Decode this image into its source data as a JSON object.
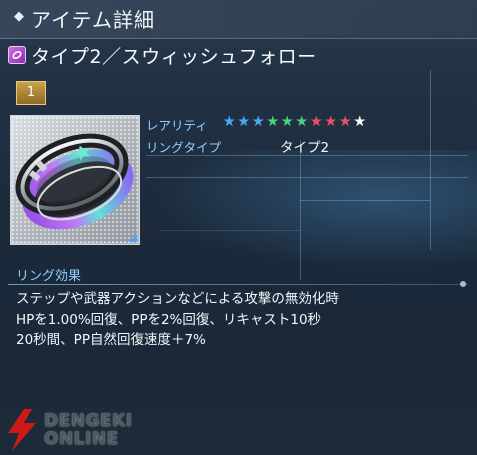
{
  "header": {
    "title": "アイテム詳細",
    "marker_icon": "diamond-icon"
  },
  "item": {
    "type_icon": "ring-type-icon",
    "name": "タイプ2／スウィッシュフォロー",
    "count": "1"
  },
  "properties": {
    "rarity_label": "レアリティ",
    "rarity_stars": 10,
    "rarity_star_colors": [
      "#4aa8f0",
      "#4aa8f0",
      "#4aa8f0",
      "#4cd07c",
      "#4cd07c",
      "#4cd07c",
      "#e8506a",
      "#e8506a",
      "#e8506a",
      "#ffffff"
    ],
    "ring_type_label": "リングタイプ",
    "ring_type_value": "タイプ2"
  },
  "effect": {
    "label": "リング効果",
    "lines": [
      "ステップや武器アクションなどによる攻撃の無効化時",
      "HPを1.00%回復、PPを2%回復、リキャスト10秒",
      "20秒間、PP自然回復速度＋7%"
    ]
  },
  "watermark": {
    "line1": "DENGEKI",
    "line2": "ONLINE"
  }
}
